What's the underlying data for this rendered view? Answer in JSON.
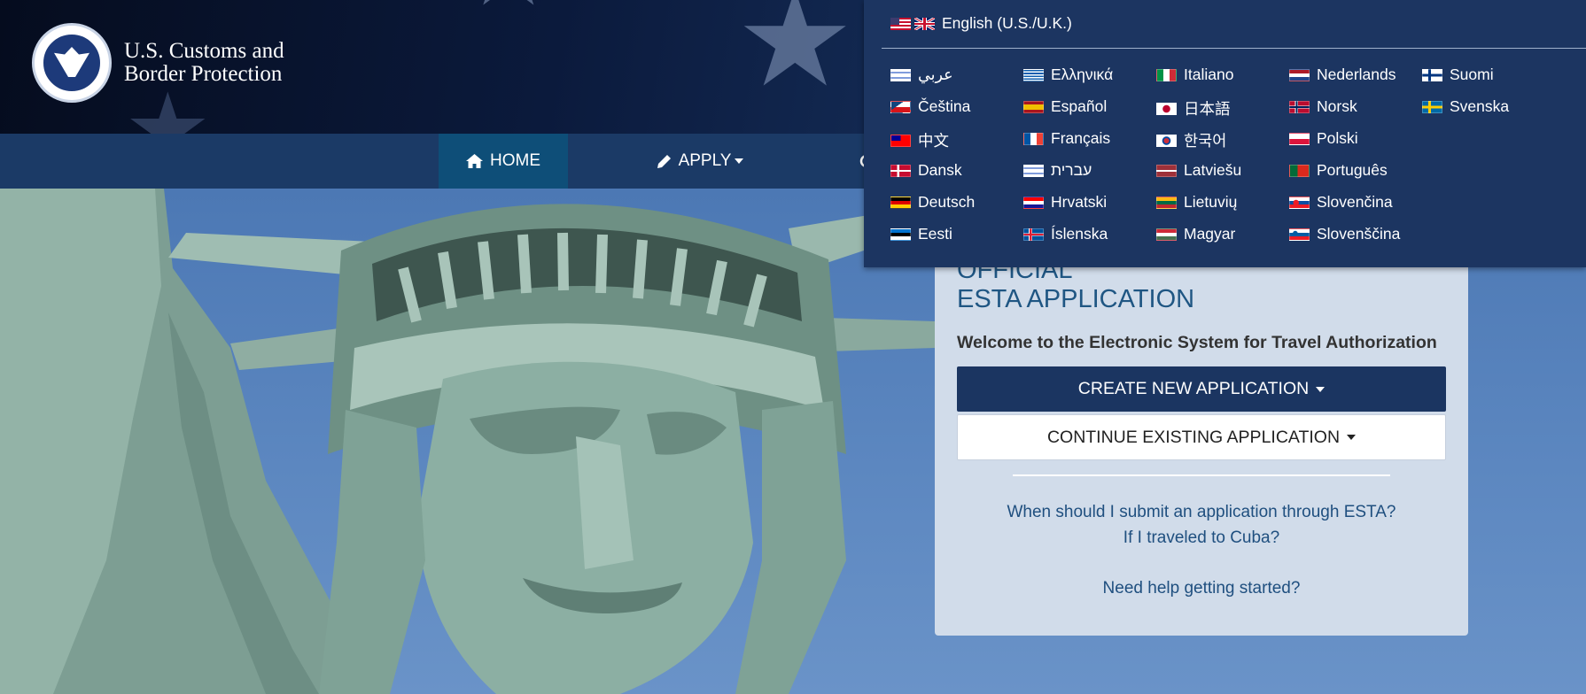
{
  "brand": {
    "line1": "U.S. Customs and",
    "line2": "Border Protection"
  },
  "nav": {
    "home": "HOME",
    "apply": "APPLY"
  },
  "card": {
    "title_line1": "OFFICIAL",
    "title_line2": "ESTA APPLICATION",
    "subtitle": "Welcome to the Electronic System for Travel Authorization",
    "create_button": "CREATE NEW APPLICATION",
    "continue_button": "CONTINUE EXISTING APPLICATION",
    "link1": "When should I submit an application through ESTA?",
    "link2": "If I traveled to Cuba?",
    "link3": "Need help getting started?"
  },
  "language": {
    "current": "English (U.S./U.K.)",
    "items": [
      "عربي",
      "Čeština",
      "中文",
      "Dansk",
      "Deutsch",
      "Eesti",
      "Ελληνικά",
      "Español",
      "Français",
      "עברית",
      "Hrvatski",
      "Íslenska",
      "Italiano",
      "日本語",
      "한국어",
      "Latviešu",
      "Lietuvių",
      "Magyar",
      "Nederlands",
      "Norsk",
      "Polski",
      "Português",
      "Slovenčina",
      "Slovenščina",
      "Suomi",
      "Svenska"
    ]
  },
  "colors": {
    "navy": "#1b3561",
    "nav_bar": "#1b3a66",
    "home_active": "#0e4e78",
    "card_bg": "#d1dcea",
    "title_blue": "#1f5683"
  }
}
